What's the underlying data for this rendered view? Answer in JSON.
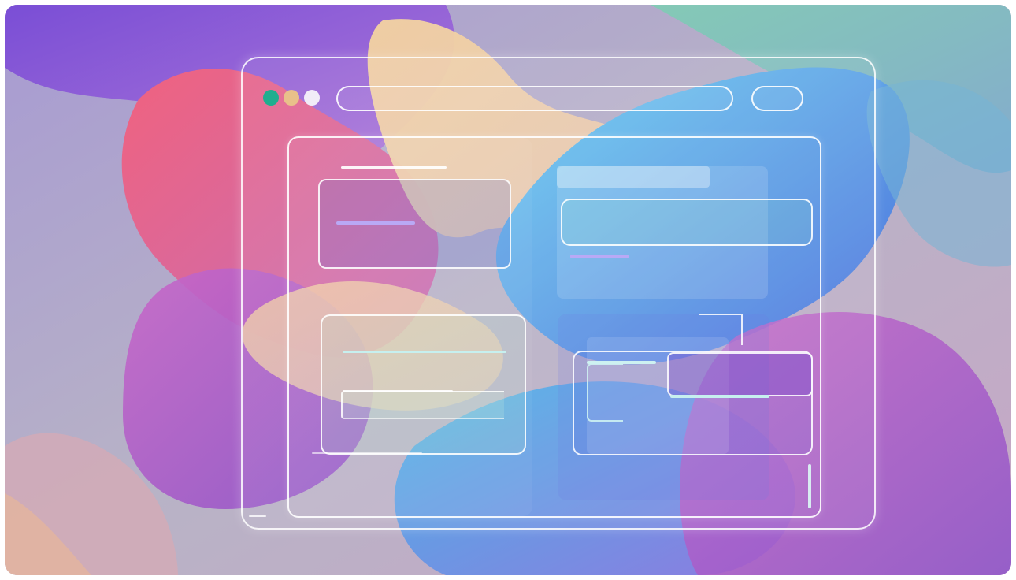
{
  "illustration": {
    "subject": "browser-window-wireframe",
    "window_controls": [
      "green-dot",
      "yellow-dot",
      "white-dot"
    ],
    "colors": {
      "control_green": "#1fae8f",
      "control_yellow": "#e9c08a",
      "control_white": "#f1ecf8",
      "outline": "#ffffff",
      "accent_line": "#b9a9f5",
      "blob_purple": "#8a50d4",
      "blob_pink": "#ec6a95",
      "blob_yellow": "#f3d7a0",
      "blob_blue": "#5bb0ee",
      "blob_teal": "#7ac6bf",
      "background": "#b7a9c4"
    }
  }
}
